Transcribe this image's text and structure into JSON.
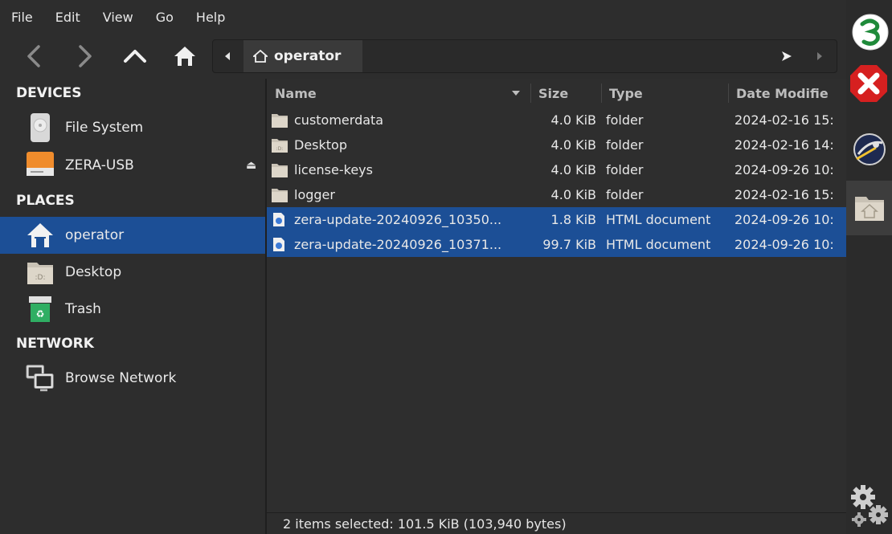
{
  "menu": [
    "File",
    "Edit",
    "View",
    "Go",
    "Help"
  ],
  "path": {
    "current": "operator"
  },
  "sidebar": {
    "devices_heading": "DEVICES",
    "places_heading": "PLACES",
    "network_heading": "NETWORK",
    "devices": [
      {
        "label": "File System",
        "icon": "drive-icon"
      },
      {
        "label": "ZERA-USB",
        "icon": "usb-drive-icon"
      }
    ],
    "places": [
      {
        "label": "operator",
        "icon": "home-folder-icon",
        "selected": true
      },
      {
        "label": "Desktop",
        "icon": "desktop-folder-icon"
      },
      {
        "label": "Trash",
        "icon": "trash-icon"
      }
    ],
    "network": [
      {
        "label": "Browse Network",
        "icon": "network-icon"
      }
    ]
  },
  "columns": {
    "name": "Name",
    "size": "Size",
    "type": "Type",
    "date": "Date Modifie"
  },
  "files": [
    {
      "name": "customerdata",
      "size": "4.0 KiB",
      "type": "folder",
      "date": "2024-02-16 15:",
      "kind": "folder",
      "selected": false
    },
    {
      "name": "Desktop",
      "size": "4.0 KiB",
      "type": "folder",
      "date": "2024-02-16 14:",
      "kind": "desktop",
      "selected": false
    },
    {
      "name": "license-keys",
      "size": "4.0 KiB",
      "type": "folder",
      "date": "2024-09-26 10:",
      "kind": "folder",
      "selected": false
    },
    {
      "name": "logger",
      "size": "4.0 KiB",
      "type": "folder",
      "date": "2024-02-16 15:",
      "kind": "folder",
      "selected": false
    },
    {
      "name": "zera-update-20240926_10350...",
      "size": "1.8 KiB",
      "type": "HTML document",
      "date": "2024-09-26 10:",
      "kind": "html",
      "selected": true
    },
    {
      "name": "zera-update-20240926_10371...",
      "size": "99.7 KiB",
      "type": "HTML document",
      "date": "2024-09-26 10:",
      "kind": "html",
      "selected": true
    }
  ],
  "status": "2 items selected: 101.5 KiB (103,940 bytes)",
  "dock": [
    "zera-logo-icon",
    "close-icon",
    "browser-icon",
    "home-folder-icon",
    "gears-icon"
  ],
  "colors": {
    "selection": "#1c4f96",
    "background": "#2d2d2d",
    "folder": "#c9c2b5"
  }
}
